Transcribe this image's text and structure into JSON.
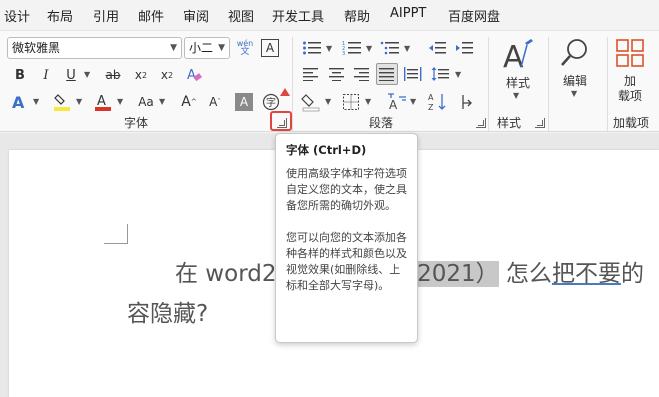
{
  "menu": [
    "设计",
    "布局",
    "引用",
    "邮件",
    "审阅",
    "视图",
    "开发工具",
    "帮助",
    "AIPPT",
    "百度网盘"
  ],
  "font": {
    "family": "微软雅黑",
    "size": "小二",
    "wen_label": "wén",
    "wen_sub": "文",
    "clear_label": "A",
    "group_label": "字体",
    "aa_label": "Aa"
  },
  "paragraph": {
    "group_label": "段落"
  },
  "styles": {
    "label": "样式",
    "group_label": "样式"
  },
  "editing": {
    "label": "编辑"
  },
  "addins": {
    "label_line1": "加",
    "label_line2": "载项",
    "group_label": "加载项"
  },
  "document": {
    "line1_a": "在 word2",
    "line1_b": "d2021）",
    "line1_c": " 怎么",
    "line1_d": "把不要",
    "line1_e": "的",
    "line2": "容隐藏?"
  },
  "tooltip": {
    "title": "字体 (Ctrl+D)",
    "para1": "使用高级字体和字符选项自定义您的文本，使之具备您所需的确切外观。",
    "para2": "您可以向您的文本添加各种各样的样式和颜色以及视觉效果(如删除线、上标和全部大写字母)。"
  },
  "colors": {
    "accent": "#3b6fc9",
    "highlight": "#f5e93b",
    "font_color": "#d9342b",
    "callout": "#e0453f"
  }
}
